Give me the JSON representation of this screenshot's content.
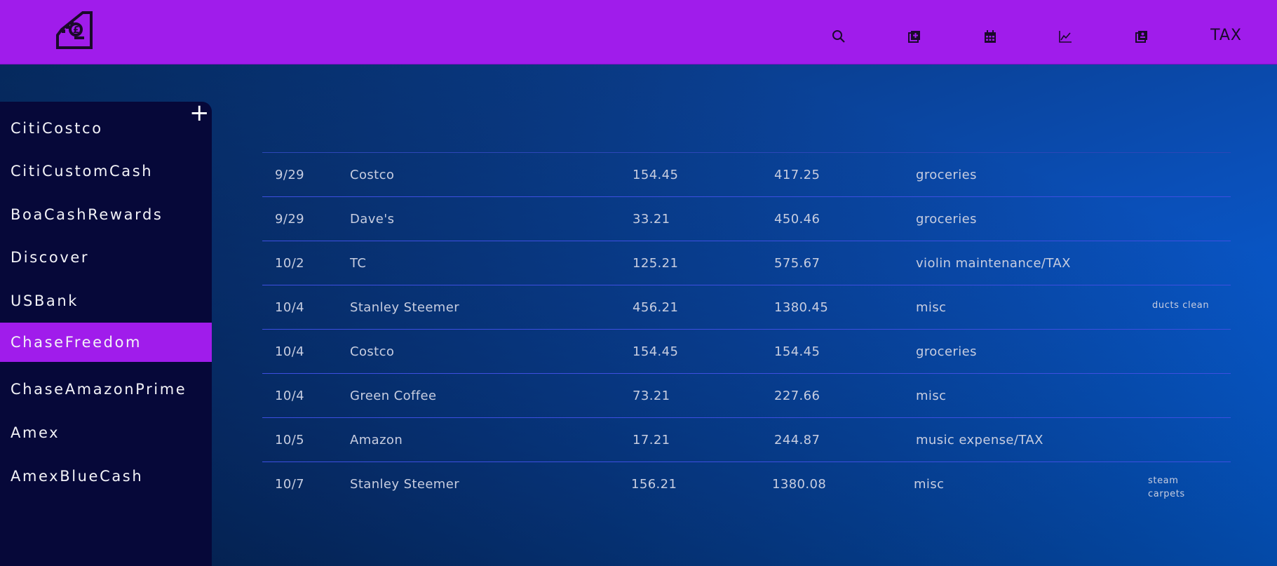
{
  "header": {
    "logo_icon": "cash-register-icon",
    "nav": [
      {
        "icon": "search-icon"
      },
      {
        "icon": "add-entry-icon"
      },
      {
        "icon": "calendar-icon"
      },
      {
        "icon": "chart-icon"
      },
      {
        "icon": "book-icon"
      }
    ],
    "tax_label": "TAX",
    "bar_color": "#a01ceb"
  },
  "sidebar": {
    "add_label": "+",
    "accounts": [
      {
        "label": "CitiCostco",
        "active": false
      },
      {
        "label": "CitiCustomCash",
        "active": false
      },
      {
        "label": "BoaCashRewards",
        "active": false
      },
      {
        "label": "Discover",
        "active": false
      },
      {
        "label": "USBank",
        "active": false
      },
      {
        "label": "ChaseFreedom",
        "active": true
      },
      {
        "label": "ChaseAmazonPrime",
        "active": false
      },
      {
        "label": "Amex",
        "active": false
      },
      {
        "label": "AmexBlueCash",
        "active": false
      }
    ]
  },
  "transactions": [
    {
      "date": "9/29",
      "description": "Costco",
      "amount": "154.45",
      "balance": "417.25",
      "category": "groceries",
      "note": ""
    },
    {
      "date": "9/29",
      "description": "Dave's",
      "amount": "33.21",
      "balance": "450.46",
      "category": "groceries",
      "note": ""
    },
    {
      "date": "10/2",
      "description": "TC",
      "amount": "125.21",
      "balance": "575.67",
      "category": "violin maintenance/TAX",
      "note": ""
    },
    {
      "date": "10/4",
      "description": "Stanley Steemer",
      "amount": "456.21",
      "balance": "1380.45",
      "category": "misc",
      "note": "ducts clean"
    },
    {
      "date": "10/4",
      "description": "Costco",
      "amount": "154.45",
      "balance": "154.45",
      "category": "groceries",
      "note": ""
    },
    {
      "date": "10/4",
      "description": "Green Coffee",
      "amount": "73.21",
      "balance": "227.66",
      "category": "misc",
      "note": ""
    },
    {
      "date": "10/5",
      "description": "Amazon",
      "amount": "17.21",
      "balance": "244.87",
      "category": "music expense/TAX",
      "note": ""
    },
    {
      "date": "10/7",
      "description": "Stanley Steemer",
      "amount": "156.21",
      "balance": "1380.08",
      "category": "misc",
      "note": "steam carpets"
    }
  ]
}
